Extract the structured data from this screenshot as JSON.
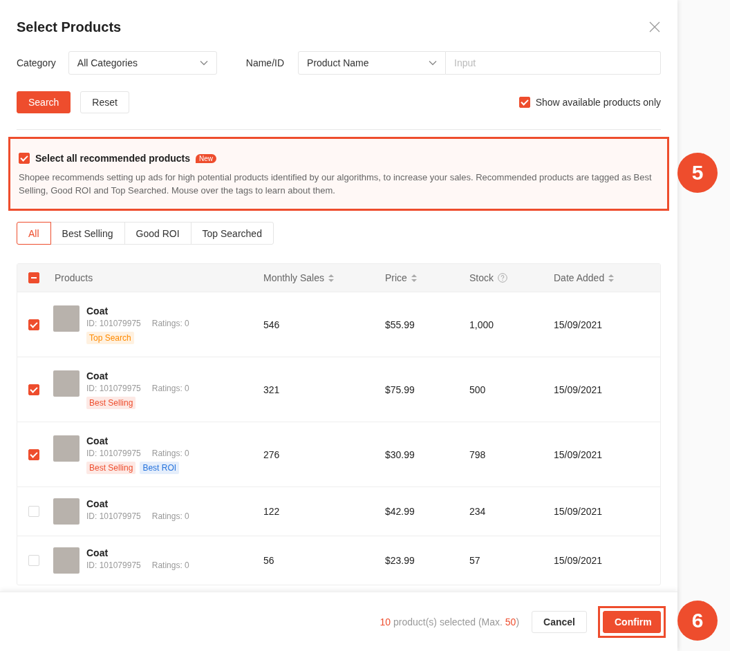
{
  "dialog": {
    "title": "Select Products"
  },
  "filters": {
    "category_label": "Category",
    "category_value": "All Categories",
    "name_label": "Name/ID",
    "name_mode": "Product Name",
    "input_placeholder": "Input"
  },
  "buttons": {
    "search": "Search",
    "reset": "Reset"
  },
  "available_only": {
    "label": "Show available products only",
    "checked": true
  },
  "recommend": {
    "label": "Select all recommended products",
    "checked": true,
    "badge": "New",
    "description": "Shopee recommends setting up ads for high potential products identified by our algorithms, to increase your sales. Recommended products are tagged as Best Selling, Good ROI and Top Searched. Mouse over the tags to learn about them.",
    "highlighted": true
  },
  "tabs": [
    {
      "label": "All",
      "selected": true
    },
    {
      "label": "Best Selling",
      "selected": false
    },
    {
      "label": "Good ROI",
      "selected": false
    },
    {
      "label": "Top Searched",
      "selected": false
    }
  ],
  "table": {
    "select_all_checked": true,
    "select_all_partial": true,
    "columns": [
      {
        "label": "Products",
        "kind": "plain"
      },
      {
        "label": "Monthly Sales",
        "kind": "sort"
      },
      {
        "label": "Price",
        "kind": "sort"
      },
      {
        "label": "Stock",
        "kind": "help"
      },
      {
        "label": "Date Added",
        "kind": "sort"
      }
    ],
    "rows": [
      {
        "checked": true,
        "name": "Coat",
        "id": "ID: 101079975",
        "ratings": "Ratings: 0",
        "tags": [
          {
            "label": "Top Search",
            "color": "#ff8a00"
          }
        ],
        "sales": "546",
        "price": "$55.99",
        "stock": "1,000",
        "date": "15/09/2021"
      },
      {
        "checked": true,
        "name": "Coat",
        "id": "ID: 101079975",
        "ratings": "Ratings: 0",
        "tags": [
          {
            "label": "Best Selling",
            "color": "#ee4d2d"
          }
        ],
        "sales": "321",
        "price": "$75.99",
        "stock": "500",
        "date": "15/09/2021"
      },
      {
        "checked": true,
        "name": "Coat",
        "id": "ID: 101079975",
        "ratings": "Ratings: 0",
        "tags": [
          {
            "label": "Best Selling",
            "color": "#ee4d2d"
          },
          {
            "label": "Best ROI",
            "color": "#2673dd"
          }
        ],
        "sales": "276",
        "price": "$30.99",
        "stock": "798",
        "date": "15/09/2021"
      },
      {
        "checked": false,
        "name": "Coat",
        "id": "ID: 101079975",
        "ratings": "Ratings: 0",
        "tags": [],
        "sales": "122",
        "price": "$42.99",
        "stock": "234",
        "date": "15/09/2021"
      },
      {
        "checked": false,
        "name": "Coat",
        "id": "ID: 101079975",
        "ratings": "Ratings: 0",
        "tags": [],
        "sales": "56",
        "price": "$23.99",
        "stock": "57",
        "date": "15/09/2021"
      }
    ]
  },
  "footer": {
    "count": "10",
    "label": "product(s) selected (Max.",
    "max": "50",
    "close": ")",
    "cancel": "Cancel",
    "confirm": "Confirm",
    "confirm_highlighted": true
  },
  "callouts": [
    {
      "number": "5"
    },
    {
      "number": "6"
    }
  ]
}
